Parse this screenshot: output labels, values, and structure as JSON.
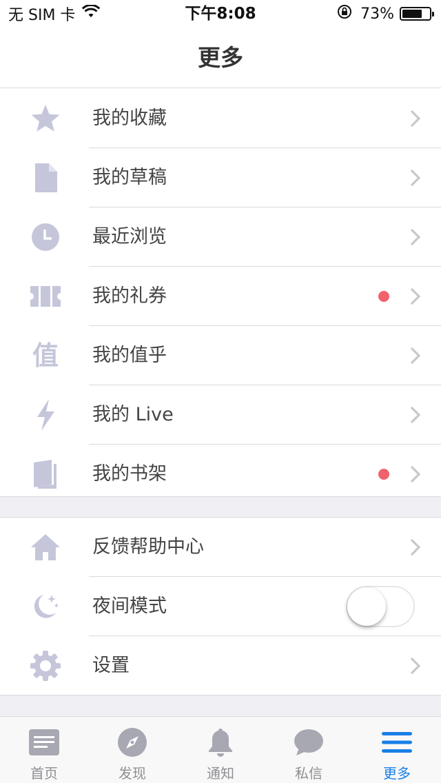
{
  "status_bar": {
    "carrier": "无 SIM 卡",
    "time": "下午8:08",
    "battery": "73%",
    "battery_level": 0.73
  },
  "header": {
    "title": "更多"
  },
  "menu_group1": [
    {
      "label": "我的收藏",
      "icon": "star-icon",
      "has_dot": false
    },
    {
      "label": "我的草稿",
      "icon": "document-icon",
      "has_dot": false
    },
    {
      "label": "最近浏览",
      "icon": "clock-icon",
      "has_dot": false
    },
    {
      "label": "我的礼券",
      "icon": "ticket-icon",
      "has_dot": true
    },
    {
      "label": "我的值乎",
      "icon": "zhihu-value-icon",
      "icon_text": "值",
      "has_dot": false
    },
    {
      "label": "我的 Live",
      "icon": "lightning-icon",
      "has_dot": false
    },
    {
      "label": "我的书架",
      "icon": "book-icon",
      "has_dot": true
    }
  ],
  "menu_group2": [
    {
      "label": "反馈帮助中心",
      "icon": "home-icon"
    },
    {
      "label": "夜间模式",
      "icon": "moon-icon",
      "toggle": false
    },
    {
      "label": "设置",
      "icon": "gear-icon"
    }
  ],
  "tabs": [
    {
      "label": "首页",
      "icon": "feed-icon",
      "active": false
    },
    {
      "label": "发现",
      "icon": "compass-icon",
      "active": false
    },
    {
      "label": "通知",
      "icon": "bell-icon",
      "active": false
    },
    {
      "label": "私信",
      "icon": "chat-bubble-icon",
      "active": false
    },
    {
      "label": "更多",
      "icon": "menu-icon",
      "active": true
    }
  ],
  "colors": {
    "icon": "#c5c6da",
    "chevron": "#c7c7cc",
    "dot": "#f1626d",
    "tab_active": "#1a80e6",
    "tab_inactive": "#8e8e93",
    "separator": "#d9d9de",
    "group_gap": "#efeff4"
  }
}
